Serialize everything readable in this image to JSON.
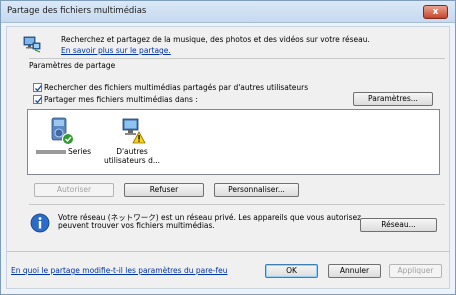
{
  "window": {
    "title": "Partage des fichiers multimédias",
    "close_label": "x"
  },
  "intro": {
    "text": "Recherchez et partagez de la musique, des photos et des vidéos sur votre réseau.",
    "link": "En savoir plus sur le partage."
  },
  "sharing": {
    "group_label": "Paramètres de partage",
    "find_label": "Rechercher des fichiers multimédias partagés par d'autres utilisateurs",
    "find_checked": true,
    "share_label": "Partager mes fichiers multimédias dans :",
    "share_checked": true,
    "settings_button": "Paramètres..."
  },
  "devices": [
    {
      "name": "Series",
      "masked_prefix": true,
      "icon": "media-device-allowed-icon"
    },
    {
      "name": "D'autres utilisateurs d...",
      "icon": "other-users-warning-icon"
    }
  ],
  "device_buttons": {
    "allow": "Autoriser",
    "deny": "Refuser",
    "customize": "Personnaliser..."
  },
  "network": {
    "text_line1": "Votre réseau (ネットワーク) est un réseau privé. Les appareils que vous autorisez",
    "text_line2": "peuvent trouver vos fichiers multimédias.",
    "button": "Réseau..."
  },
  "footer": {
    "firewall_link": "En quoi le partage modifie-t-il les paramètres du pare-feu",
    "ok": "OK",
    "cancel": "Annuler",
    "apply": "Appliquer"
  }
}
